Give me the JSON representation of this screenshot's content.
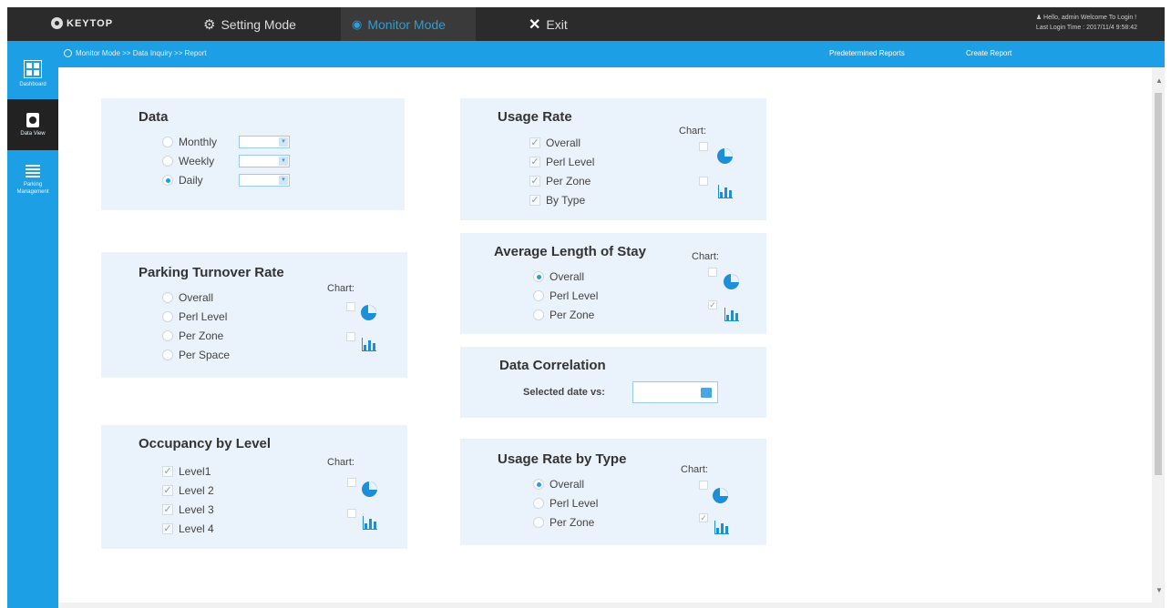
{
  "header": {
    "logo": "KEYTOP",
    "modes": [
      {
        "label": "Setting  Mode"
      },
      {
        "label": "Monitor Mode"
      },
      {
        "label": "Exit"
      }
    ],
    "user_line1": "Hello, admin Welcome To Login !",
    "user_line2": "Last Login Time : 2017/11/4 9:58:42"
  },
  "breadcrumb": "Monitor Mode >> Data Inquiry >> Report",
  "top_links": [
    "Predetermined Reports",
    "Create Report"
  ],
  "sidebar": {
    "items": [
      {
        "label": "Dashboard",
        "icon": "dashboard-icon"
      },
      {
        "label": "Data View",
        "icon": "camera-icon"
      },
      {
        "label": "Parking Management",
        "icon": "list-icon"
      }
    ]
  },
  "chart_label": "Chart:",
  "panels": {
    "data": {
      "title": "Data",
      "options": [
        "Monthly",
        "Weekly",
        "Daily"
      ],
      "selected": "Daily"
    },
    "turnover": {
      "title": "Parking Turnover Rate",
      "options": [
        "Overall",
        "Perl Level",
        "Per Zone",
        "Per Space"
      ]
    },
    "occupancy": {
      "title": "Occupancy by Level",
      "options": [
        "Level1",
        "Level 2",
        "Level 3",
        "Level 4"
      ]
    },
    "usage": {
      "title": "Usage Rate",
      "options": [
        "Overall",
        "Perl Level",
        "Per Zone",
        "By Type"
      ]
    },
    "avgstay": {
      "title": "Average Length of Stay",
      "options": [
        "Overall",
        "Perl Level",
        "Per Zone"
      ],
      "selected": "Overall"
    },
    "correlation": {
      "title": "Data Correlation",
      "label": "Selected date vs:"
    },
    "usagetype": {
      "title": "Usage Rate by Type",
      "options": [
        "Overall",
        "Perl Level",
        "Per Zone"
      ],
      "selected": "Overall"
    }
  },
  "colors": {
    "accent": "#1d9fe6",
    "topbar": "#2b2b2b",
    "panel": "#eaf2fb"
  }
}
